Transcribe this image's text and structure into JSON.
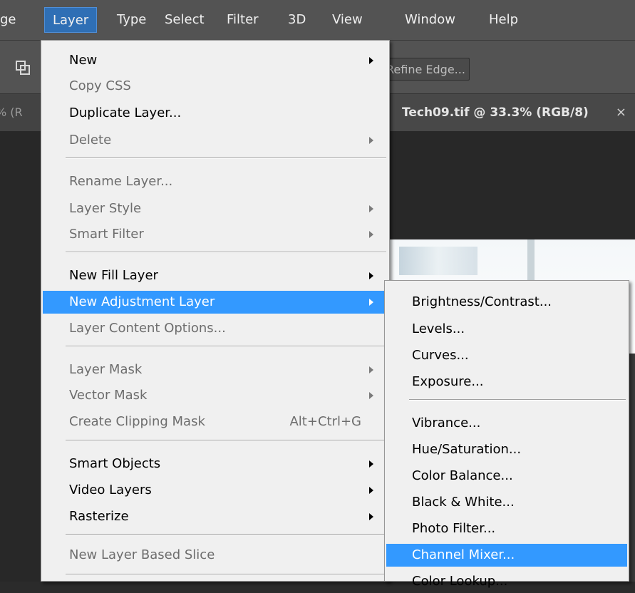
{
  "menubar": {
    "items": [
      {
        "label": "ge"
      },
      {
        "label": "Layer"
      },
      {
        "label": "Type"
      },
      {
        "label": "Select"
      },
      {
        "label": "Filter"
      },
      {
        "label": "3D"
      },
      {
        "label": "View"
      },
      {
        "label": "Window"
      },
      {
        "label": "Help"
      }
    ]
  },
  "options_bar": {
    "refine_edge_label": "Refine Edge...",
    "arrange_icon": "arrange-icon"
  },
  "tabs": {
    "left_tab_label": "% (R",
    "active_tab_label": "Tech09.tif @ 33.3% (RGB/8)",
    "close_glyph": "×"
  },
  "layer_menu": {
    "items": [
      {
        "label": "New",
        "enabled": true,
        "submenu": true
      },
      {
        "label": "Copy CSS",
        "enabled": false
      },
      {
        "label": "Duplicate Layer...",
        "enabled": true
      },
      {
        "label": "Delete",
        "enabled": false,
        "submenu": true
      },
      {
        "label": "Rename Layer...",
        "enabled": false
      },
      {
        "label": "Layer Style",
        "enabled": false,
        "submenu": true
      },
      {
        "label": "Smart Filter",
        "enabled": false,
        "submenu": true
      },
      {
        "label": "New Fill Layer",
        "enabled": true,
        "submenu": true
      },
      {
        "label": "New Adjustment Layer",
        "enabled": true,
        "submenu": true,
        "highlighted": true
      },
      {
        "label": "Layer Content Options...",
        "enabled": false
      },
      {
        "label": "Layer Mask",
        "enabled": false,
        "submenu": true
      },
      {
        "label": "Vector Mask",
        "enabled": false,
        "submenu": true
      },
      {
        "label": "Create Clipping Mask",
        "enabled": false,
        "shortcut": "Alt+Ctrl+G"
      },
      {
        "label": "Smart Objects",
        "enabled": true,
        "submenu": true
      },
      {
        "label": "Video Layers",
        "enabled": true,
        "submenu": true
      },
      {
        "label": "Rasterize",
        "enabled": true,
        "submenu": true
      },
      {
        "label": "New Layer Based Slice",
        "enabled": false
      }
    ]
  },
  "adjustment_submenu": {
    "items": [
      {
        "label": "Brightness/Contrast..."
      },
      {
        "label": "Levels..."
      },
      {
        "label": "Curves..."
      },
      {
        "label": "Exposure..."
      },
      {
        "label": "Vibrance..."
      },
      {
        "label": "Hue/Saturation..."
      },
      {
        "label": "Color Balance..."
      },
      {
        "label": "Black & White..."
      },
      {
        "label": "Photo Filter..."
      },
      {
        "label": "Channel Mixer...",
        "highlighted": true
      },
      {
        "label": "Color Lookup..."
      }
    ]
  },
  "colors": {
    "menu_bg": "#f0f0f0",
    "highlight": "#3399ff",
    "disabled_text": "#6d6d6d",
    "app_bar": "#535353"
  }
}
